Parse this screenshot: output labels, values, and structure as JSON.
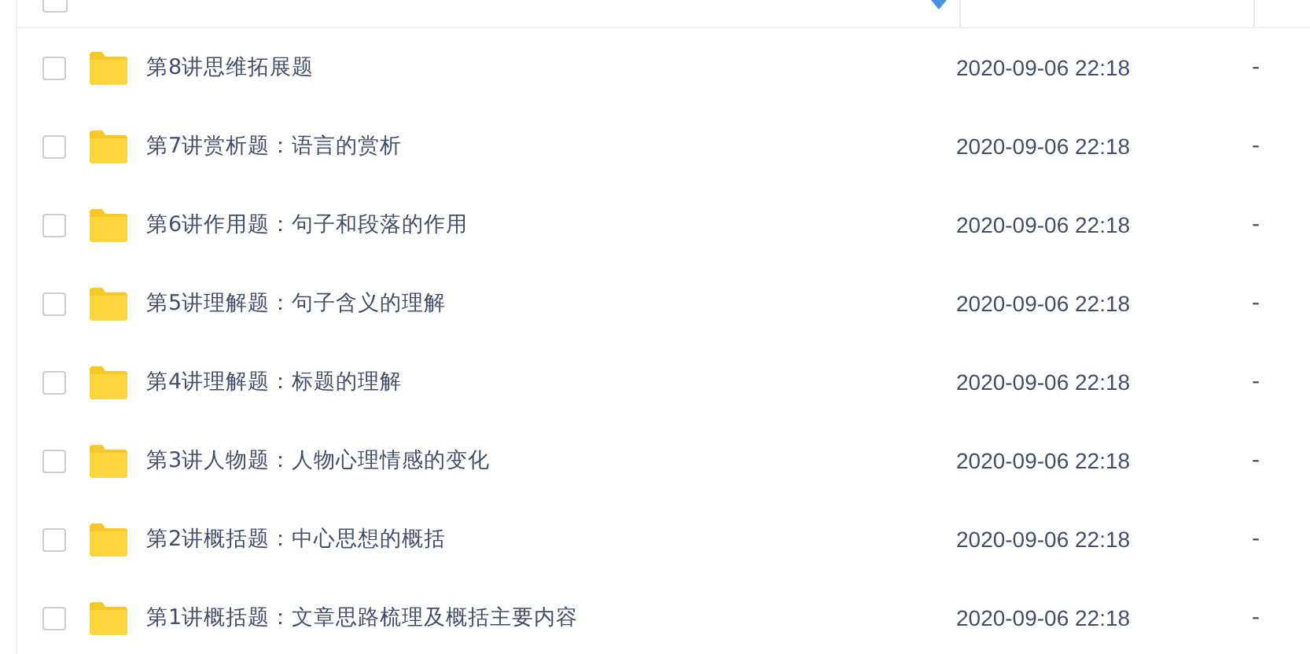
{
  "select_all": {
    "checked": false
  },
  "files": [
    {
      "name": "第8讲思维拓展题",
      "modified": "2020-09-06 22:18",
      "size": "-",
      "checked": false
    },
    {
      "name": "第7讲赏析题：语言的赏析",
      "modified": "2020-09-06 22:18",
      "size": "-",
      "checked": false
    },
    {
      "name": "第6讲作用题：句子和段落的作用",
      "modified": "2020-09-06 22:18",
      "size": "-",
      "checked": false
    },
    {
      "name": "第5讲理解题：句子含义的理解",
      "modified": "2020-09-06 22:18",
      "size": "-",
      "checked": false
    },
    {
      "name": "第4讲理解题：标题的理解",
      "modified": "2020-09-06 22:18",
      "size": "-",
      "checked": false
    },
    {
      "name": "第3讲人物题：人物心理情感的变化",
      "modified": "2020-09-06 22:18",
      "size": "-",
      "checked": false
    },
    {
      "name": "第2讲概括题：中心思想的概括",
      "modified": "2020-09-06 22:18",
      "size": "-",
      "checked": false
    },
    {
      "name": "第1讲概括题：文章思路梳理及概括主要内容",
      "modified": "2020-09-06 22:18",
      "size": "-",
      "checked": false
    }
  ]
}
